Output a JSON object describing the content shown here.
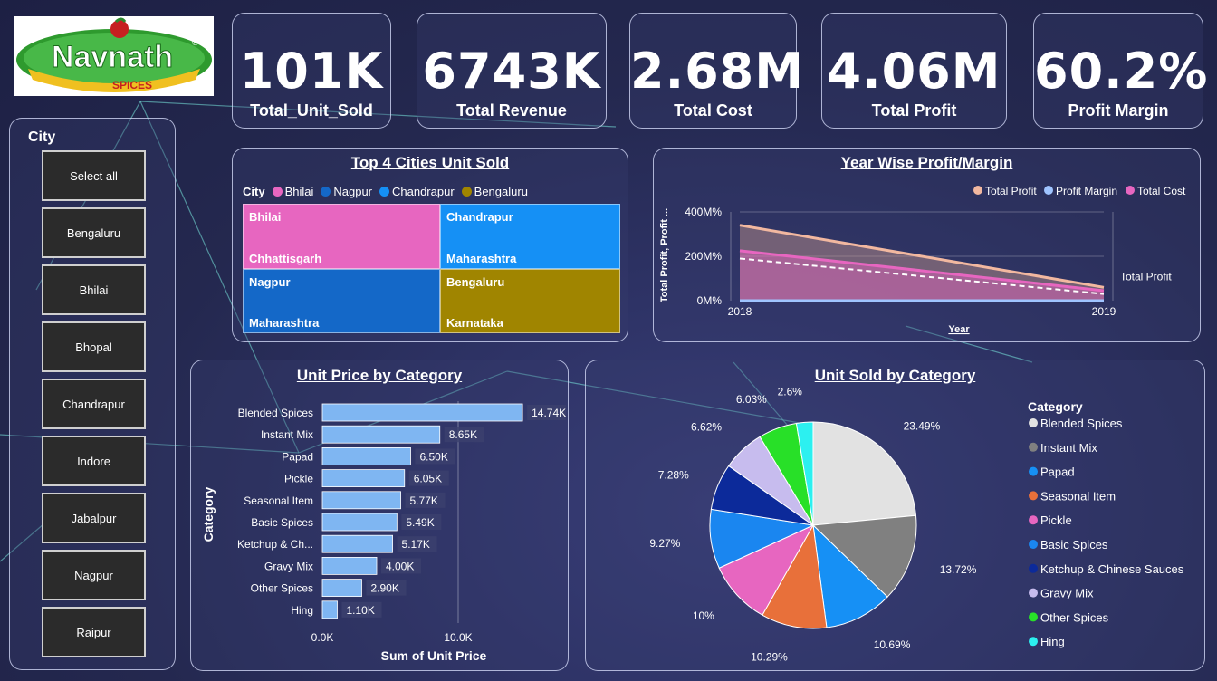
{
  "brand": {
    "name": "Navnath",
    "tagline": "SPICES",
    "reg": "®"
  },
  "kpis": [
    {
      "value": "101K",
      "label": "Total_Unit_Sold"
    },
    {
      "value": "6743K",
      "label": "Total Revenue"
    },
    {
      "value": "2.68M",
      "label": "Total Cost"
    },
    {
      "value": "4.06M",
      "label": "Total Profit"
    },
    {
      "value": "60.2%",
      "label": "Profit Margin"
    }
  ],
  "city_slicer": {
    "title": "City",
    "items": [
      "Select all",
      "Bengaluru",
      "Bhilai",
      "Bhopal",
      "Chandrapur",
      "Indore",
      "Jabalpur",
      "Nagpur",
      "Raipur"
    ]
  },
  "treemap": {
    "title": "Top 4 Cities Unit Sold",
    "legend_title": "City",
    "legend": [
      {
        "name": "Bhilai",
        "color": "#e766c0"
      },
      {
        "name": "Nagpur",
        "color": "#1468c8"
      },
      {
        "name": "Chandrapur",
        "color": "#1590f5"
      },
      {
        "name": "Bengaluru",
        "color": "#a08500"
      }
    ],
    "tiles": [
      {
        "city": "Bhilai",
        "state": "Chhattisgarh",
        "color": "#e766c0"
      },
      {
        "city": "Chandrapur",
        "state": "Maharashtra",
        "color": "#1590f5"
      },
      {
        "city": "Nagpur",
        "state": "Maharashtra",
        "color": "#1468c8"
      },
      {
        "city": "Bengaluru",
        "state": "Karnataka",
        "color": "#a08500"
      }
    ]
  },
  "chart_data": [
    {
      "type": "area",
      "title": "Year Wise Profit/Margin",
      "xlabel": "Year",
      "ylabel": "Total Profit, Profit ...",
      "x": [
        "2018",
        "2019"
      ],
      "yticks": [
        "0M%",
        "200M%",
        "400M%"
      ],
      "ylim": [
        0,
        400
      ],
      "legend_placement": "top-right",
      "series": [
        {
          "name": "Total Profit",
          "values": [
            340,
            60
          ],
          "color": "#f2b8a0"
        },
        {
          "name": "Profit Margin",
          "values": [
            0,
            0
          ],
          "color": "#9fc4ff"
        },
        {
          "name": "Total Cost",
          "values": [
            225,
            45
          ],
          "color": "#e766c0"
        }
      ],
      "reference_line": [
        190,
        30
      ],
      "annotation": "Total Profit"
    },
    {
      "type": "bar",
      "title": "Unit Price by Category",
      "xlabel": "Sum of Unit Price",
      "ylabel": "Category",
      "categories": [
        "Blended Spices",
        "Instant Mix",
        "Papad",
        "Pickle",
        "Seasonal Item",
        "Basic Spices",
        "Ketchup & Ch...",
        "Gravy Mix",
        "Other Spices",
        "Hing"
      ],
      "values": [
        14740,
        8650,
        6500,
        6050,
        5770,
        5490,
        5170,
        4000,
        2900,
        1100
      ],
      "labels": [
        "14.74K",
        "8.65K",
        "6.50K",
        "6.05K",
        "5.77K",
        "5.49K",
        "5.17K",
        "4.00K",
        "2.90K",
        "1.10K"
      ],
      "xticks": [
        "0.0K",
        "10.0K"
      ],
      "xlim": [
        0,
        20000
      ],
      "color": "#7fb6f2"
    },
    {
      "type": "pie",
      "title": "Unit  Sold by Category",
      "legend_title": "Category",
      "slices": [
        {
          "name": "Blended Spices",
          "value": 23.49,
          "label": "23.49%",
          "color": "#e2e2e2"
        },
        {
          "name": "Instant Mix",
          "value": 13.72,
          "label": "13.72%",
          "color": "#808080"
        },
        {
          "name": "Papad",
          "value": 10.69,
          "label": "10.69%",
          "color": "#1690f5"
        },
        {
          "name": "Seasonal Item",
          "value": 10.29,
          "label": "10.29%",
          "color": "#e8703a"
        },
        {
          "name": "Pickle",
          "value": 10,
          "label": "10%",
          "color": "#e766c0"
        },
        {
          "name": "Basic Spices",
          "value": 9.27,
          "label": "9.27%",
          "color": "#1a86f0"
        },
        {
          "name": "Ketchup & Chinese Sauces",
          "value": 7.28,
          "label": "7.28%",
          "color": "#0c2a9a"
        },
        {
          "name": "Gravy Mix",
          "value": 6.62,
          "label": "6.62%",
          "color": "#c7bcee"
        },
        {
          "name": "Other Spices",
          "value": 6.03,
          "label": "6.03%",
          "color": "#28e028"
        },
        {
          "name": "Hing",
          "value": 2.6,
          "label": "2.6%",
          "color": "#2cf0f0"
        }
      ]
    }
  ]
}
